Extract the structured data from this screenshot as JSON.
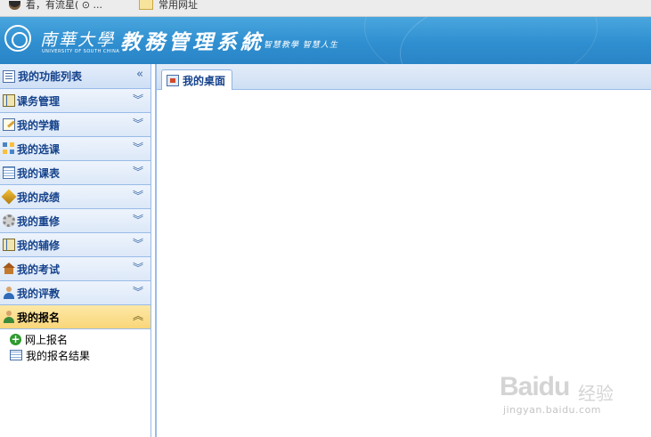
{
  "bookmarks": {
    "items": [
      {
        "label": "看，有流星( ⊙ ..."
      },
      {
        "label": "常用网址"
      }
    ]
  },
  "header": {
    "school_name": "南華大學",
    "school_name_en": "UNIVERSITY OF SOUTH CHINA",
    "system_name": "教務管理系統",
    "motto": "智慧教學 智慧人生"
  },
  "sidebar": {
    "title": "我的功能列表",
    "items": [
      {
        "label": "课务管理",
        "icon": "book-icon"
      },
      {
        "label": "我的学籍",
        "icon": "edit-icon"
      },
      {
        "label": "我的选课",
        "icon": "grid-icon"
      },
      {
        "label": "我的课表",
        "icon": "table-icon"
      },
      {
        "label": "我的成绩",
        "icon": "diamond-icon"
      },
      {
        "label": "我的重修",
        "icon": "gear-icon"
      },
      {
        "label": "我的辅修",
        "icon": "book-icon"
      },
      {
        "label": "我的考试",
        "icon": "house-icon"
      },
      {
        "label": "我的评教",
        "icon": "user-icon"
      },
      {
        "label": "我的报名",
        "icon": "user-icon",
        "active": true
      }
    ],
    "submenu": [
      {
        "label": "网上报名",
        "icon": "plus-icon"
      },
      {
        "label": "我的报名结果",
        "icon": "list-icon"
      }
    ]
  },
  "main": {
    "tabs": [
      {
        "label": "我的桌面",
        "icon": "desktop-icon"
      }
    ]
  },
  "watermark": {
    "logo": "Baidu",
    "text": "经验",
    "url": "jingyan.baidu.com"
  },
  "colors": {
    "header_blue": "#2f8fd0",
    "nav_text": "#15428b",
    "active_item": "#f9d67a",
    "border": "#99bbe8"
  }
}
